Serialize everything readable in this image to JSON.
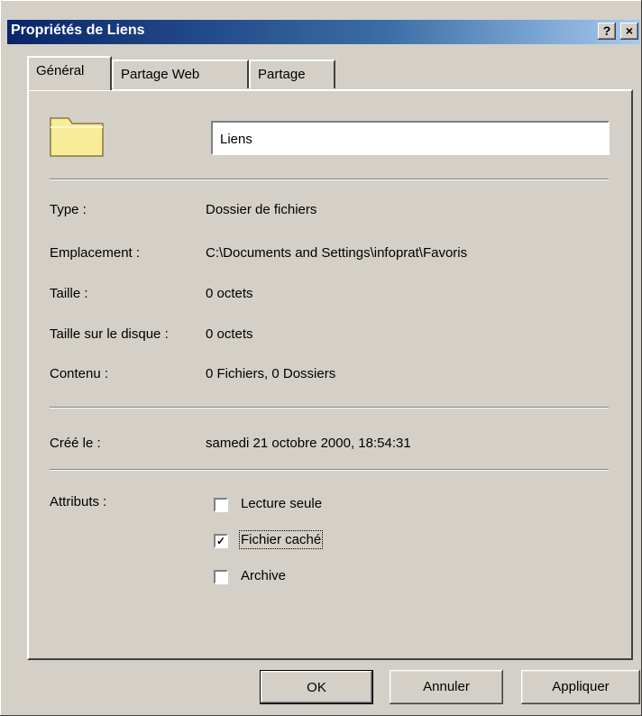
{
  "window": {
    "title": "Propriétés de Liens",
    "help_label": "?",
    "close_label": "×"
  },
  "tabs": [
    {
      "label": "Général",
      "active": true
    },
    {
      "label": "Partage Web",
      "active": false
    },
    {
      "label": "Partage",
      "active": false
    }
  ],
  "general": {
    "name_value": "Liens",
    "icon": "folder-icon",
    "properties": [
      {
        "label": "Type :",
        "value": "Dossier de fichiers"
      },
      {
        "label": "Emplacement :",
        "value": "C:\\Documents and Settings\\infoprat\\Favoris"
      },
      {
        "label": "Taille :",
        "value": "0 octets"
      },
      {
        "label": "Taille sur le disque :",
        "value": "0 octets"
      },
      {
        "label": "Contenu :",
        "value": "0 Fichiers, 0 Dossiers"
      }
    ],
    "created_label": "Créé le :",
    "created_value": "samedi 21 octobre 2000, 18:54:31",
    "attributes_label": "Attributs :",
    "attributes": [
      {
        "label": "Lecture seule",
        "checked": false
      },
      {
        "label": "Fichier caché",
        "checked": true
      },
      {
        "label": "Archive",
        "checked": false
      }
    ]
  },
  "buttons": {
    "ok": "OK",
    "cancel": "Annuler",
    "apply": "Appliquer"
  }
}
